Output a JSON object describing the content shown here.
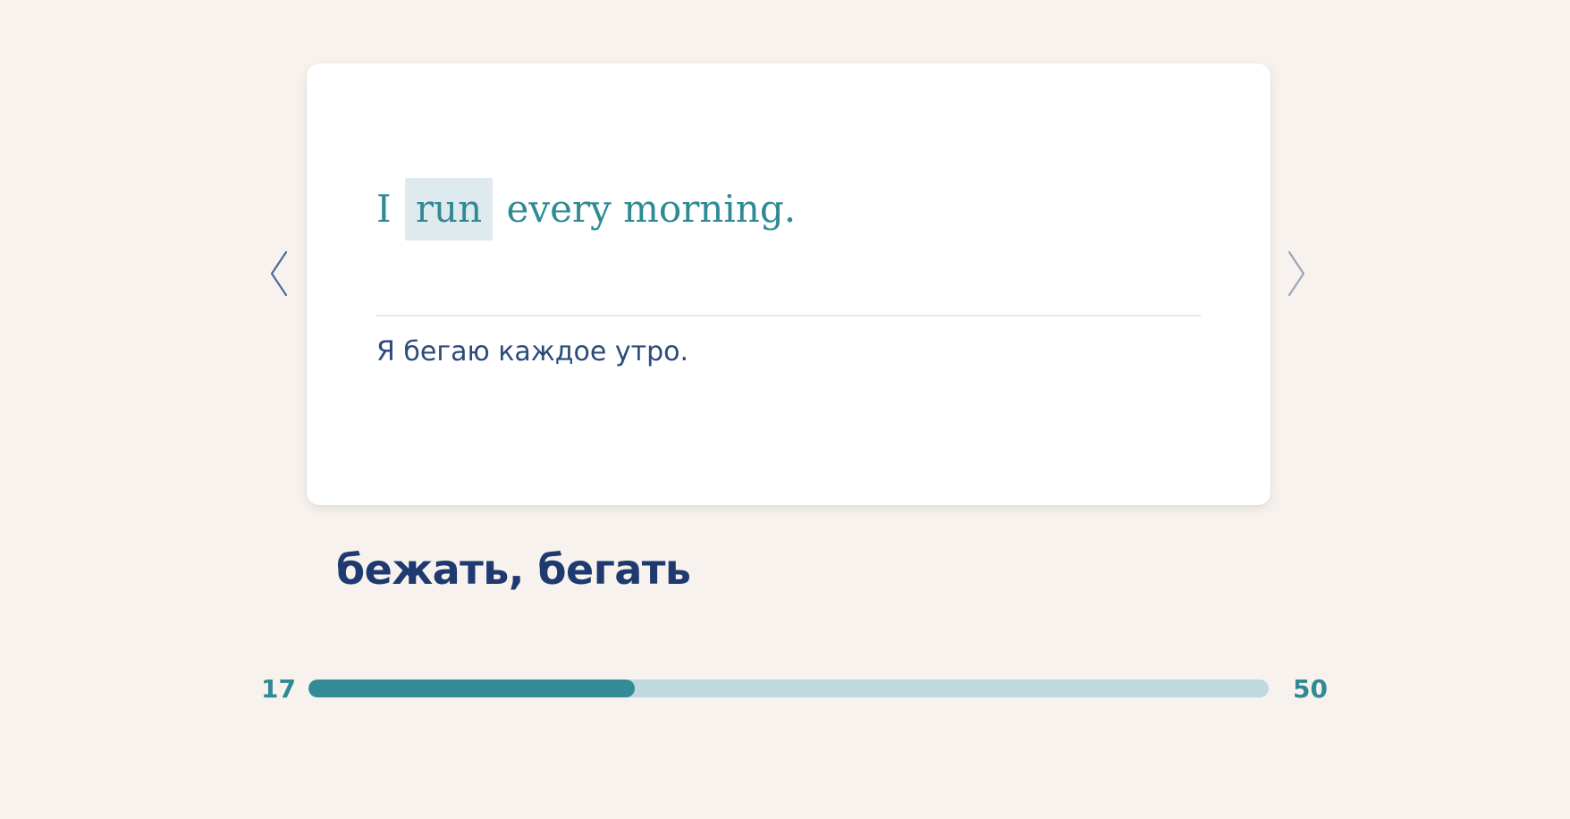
{
  "card": {
    "sentence_before": "I",
    "sentence_highlight": "run",
    "sentence_after": "every morning.",
    "translation": "Я бегаю каждое утро."
  },
  "word": {
    "translation": "бежать, бегать"
  },
  "progress": {
    "start_label": "17",
    "end_label": "50",
    "current": 17,
    "total": 50
  },
  "icons": {
    "prev": "chevron-left-icon",
    "next": "chevron-right-icon"
  },
  "colors": {
    "background": "#f7f2ee",
    "accent_teal": "#2f8a94",
    "highlight": "#dfeaef",
    "navy": "#1e3a6e",
    "track": "#bfd9de"
  }
}
